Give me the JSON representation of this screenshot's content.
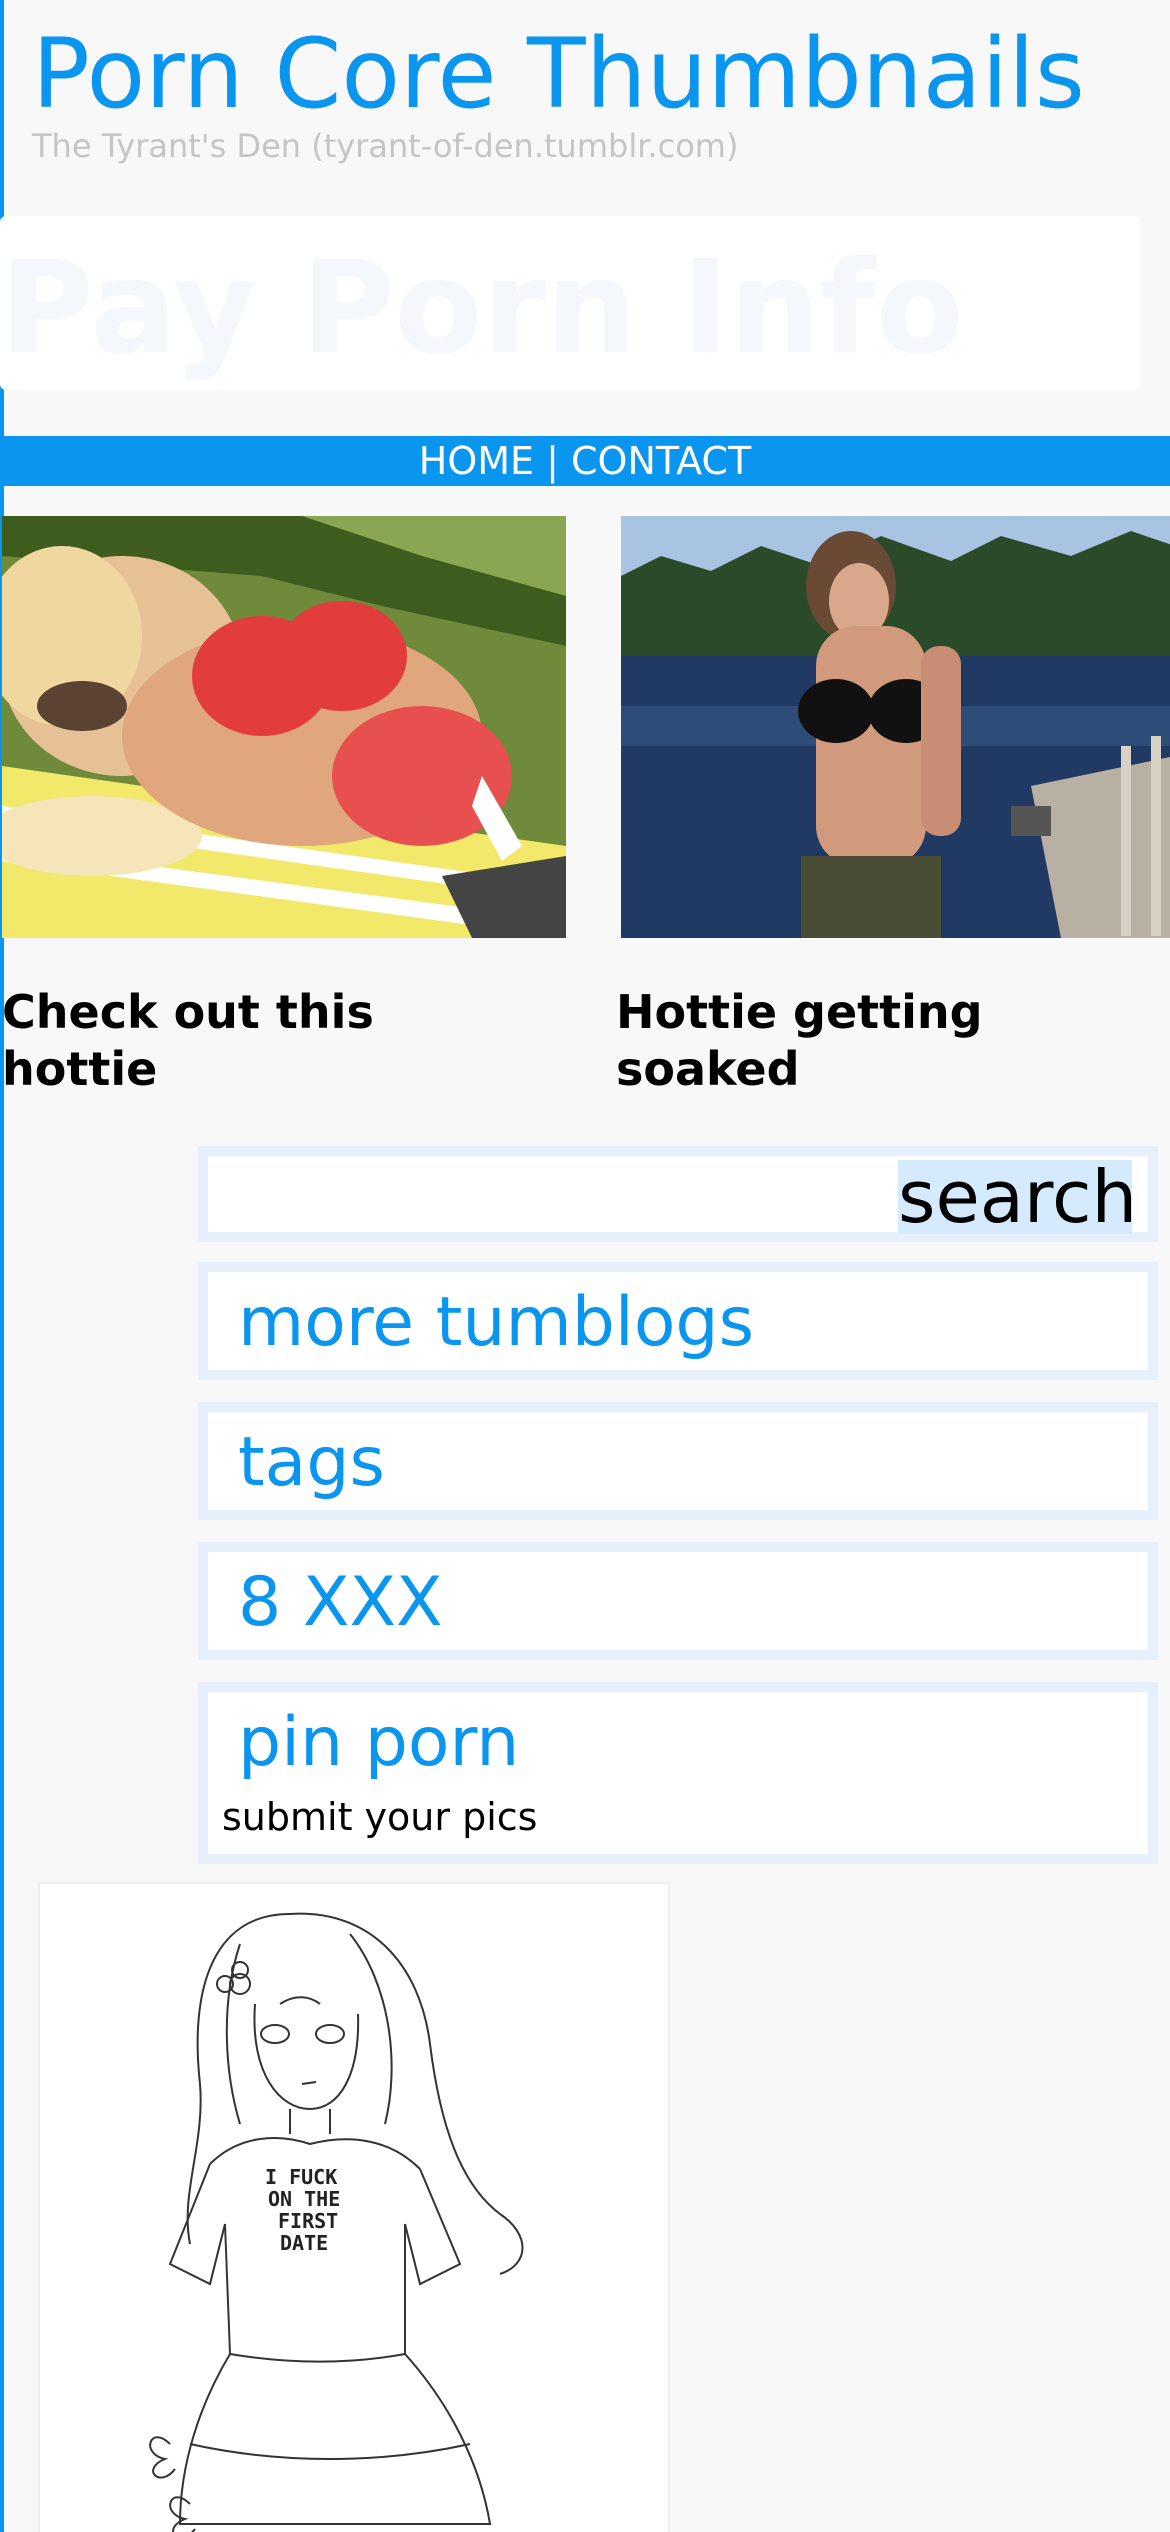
{
  "header": {
    "title": "Porn Core Thumbnails",
    "subtitle": "The Tyrant's Den (tyrant-of-den.tumblr.com)"
  },
  "banner": {
    "text": "Pay Porn Info"
  },
  "nav": {
    "home": "HOME",
    "separator": " | ",
    "contact": "CONTACT"
  },
  "posts": [
    {
      "caption": "Check out this hottie"
    },
    {
      "caption": "Hottie getting soaked"
    }
  ],
  "sidebar": {
    "search_button": "search",
    "links": [
      "more tumblogs",
      "tags",
      "8 XXX",
      "pin porn"
    ],
    "pin_sub": "submit your pics"
  },
  "card": {
    "shirt_text": [
      "I FUCK",
      "ON THE",
      "FIRST",
      "DATE"
    ]
  },
  "colors": {
    "accent": "#0a96ee",
    "box_border": "#e6f0fc",
    "search_button_bg": "#d5ebfd"
  }
}
